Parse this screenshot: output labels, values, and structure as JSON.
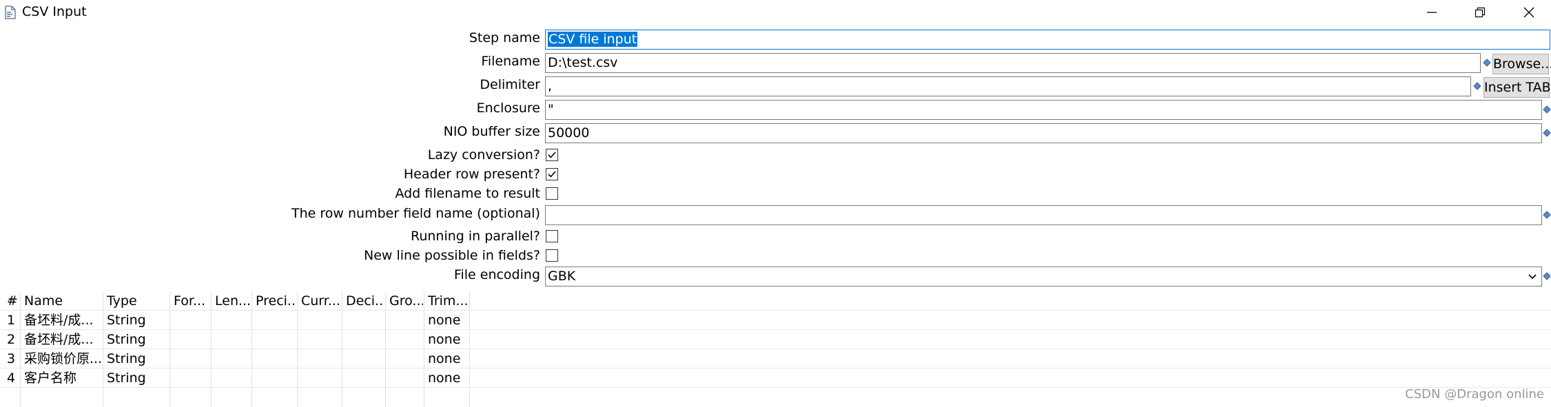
{
  "window": {
    "title": "CSV Input",
    "minimize_icon": "minimize-icon",
    "restore_icon": "restore-icon",
    "close_icon": "close-icon"
  },
  "form": {
    "step_name_label": "Step name",
    "step_name_value": "CSV file input",
    "filename_label": "Filename",
    "filename_value": "D:\\test.csv",
    "browse_label": "Browse...",
    "delimiter_label": "Delimiter",
    "delimiter_value": ",",
    "insert_tab_label": "Insert TAB",
    "enclosure_label": "Enclosure",
    "enclosure_value": "\"",
    "nio_label": "NIO buffer size",
    "nio_value": "50000",
    "lazy_label": "Lazy conversion?",
    "lazy_checked": true,
    "header_label": "Header row present?",
    "header_checked": true,
    "addfilename_label": "Add filename to result",
    "addfilename_checked": false,
    "rownum_label": "The row number field name (optional)",
    "rownum_value": "",
    "parallel_label": "Running in parallel?",
    "parallel_checked": false,
    "newline_label": "New line possible in fields?",
    "newline_checked": false,
    "encoding_label": "File encoding",
    "encoding_value": "GBK"
  },
  "table": {
    "headers": [
      "#",
      "Name",
      "Type",
      "For...",
      "Len...",
      "Preci...",
      "Curr...",
      "Deci...",
      "Gro...",
      "Trim..."
    ],
    "rows": [
      [
        "1",
        "备坯料/成...",
        "String",
        "",
        "",
        "",
        "",
        "",
        "",
        "none"
      ],
      [
        "2",
        "备坯料/成...",
        "String",
        "",
        "",
        "",
        "",
        "",
        "",
        "none"
      ],
      [
        "3",
        "采购锁价原...",
        "String",
        "",
        "",
        "",
        "",
        "",
        "",
        "none"
      ],
      [
        "4",
        "客户名称",
        "String",
        "",
        "",
        "",
        "",
        "",
        "",
        "none"
      ]
    ]
  },
  "watermark": "CSDN @Dragon online"
}
